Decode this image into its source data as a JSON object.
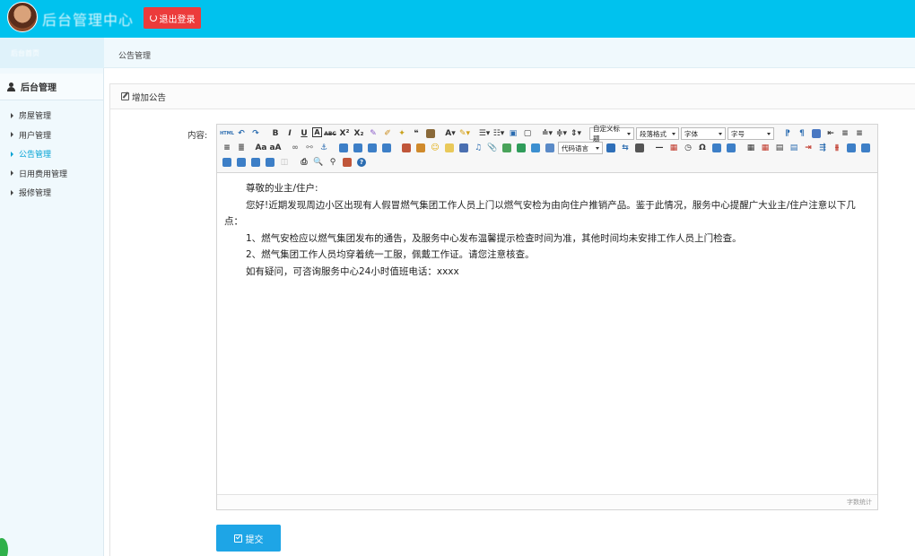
{
  "header": {
    "app_title": "后台管理中心",
    "logout_label": "退出登录"
  },
  "subheader": {
    "left_text": "后台首页",
    "breadcrumb": "公告管理"
  },
  "sidebar": {
    "section_title": "后台管理",
    "items": [
      {
        "label": "房屋管理",
        "active": false
      },
      {
        "label": "用户管理",
        "active": false
      },
      {
        "label": "公告管理",
        "active": true
      },
      {
        "label": "日用费用管理",
        "active": false
      },
      {
        "label": "报修管理",
        "active": false
      }
    ]
  },
  "panel": {
    "title": "增加公告",
    "content_label": "内容:",
    "submit_label": "提交"
  },
  "editor": {
    "toolbar_row1_combos": [
      "自定义标题",
      "段落格式",
      "字体",
      "字号"
    ],
    "toolbar_row2_combo": "代码语言",
    "paragraphs": [
      "尊敬的业主/住户:",
      "您好!近期发现周边小区出现有人假冒燃气集团工作人员上门以燃气安检为由向住户推销产品。鉴于此情况，服务中心提醒广大业主/住户注意以下几点：",
      "1、燃气安检应以燃气集团发布的通告，及服务中心发布温馨提示检查时间为准，其他时间均未安排工作人员上门检查。",
      "2、燃气集团工作人员均穿着统一工服，佩戴工作证。请您注意核查。",
      "如有疑问，可咨询服务中心24小时值班电话：xxxx"
    ],
    "word_count_label": "字数统计"
  },
  "colors": {
    "header_bg": "#00c2ee",
    "logout_bg": "#ec3b3b",
    "submit_bg": "#1ea5e6",
    "active_nav": "#00a2d4"
  }
}
